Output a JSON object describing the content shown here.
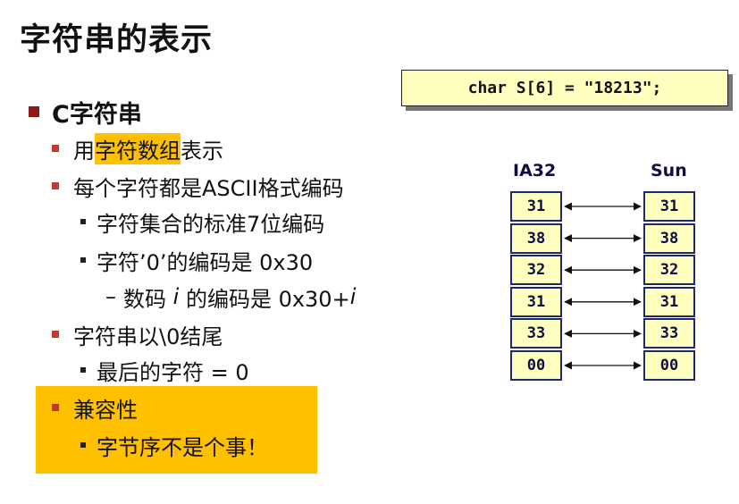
{
  "slide": {
    "title": "字符串的表示",
    "code": "char S[6] = \"18213\";",
    "bullets": {
      "main": "C字符串",
      "item1_prefix": "用",
      "item1_highlight": "字符数组",
      "item1_suffix": "表示",
      "item2": "每个字符都是ASCII格式编码",
      "item2_sub1": "字符集合的标准7位编码",
      "item2_sub2": "字符’0’的编码是 0x30",
      "item2_sub3_dash": "–",
      "item2_sub3_a": "数码 ",
      "item2_sub3_i1": "i",
      "item2_sub3_b": " 的编码是 0x30+",
      "item2_sub3_i2": "i",
      "item3": "字符串以\\0结尾",
      "item3_sub1": "最后的字符 = 0",
      "item4": "兼容性",
      "item4_sub1": "字节序不是个事！"
    },
    "diagram": {
      "left_label": "IA32",
      "right_label": "Sun",
      "left_bytes": [
        "31",
        "38",
        "32",
        "31",
        "33",
        "00"
      ],
      "right_bytes": [
        "31",
        "38",
        "32",
        "31",
        "33",
        "00"
      ]
    }
  }
}
